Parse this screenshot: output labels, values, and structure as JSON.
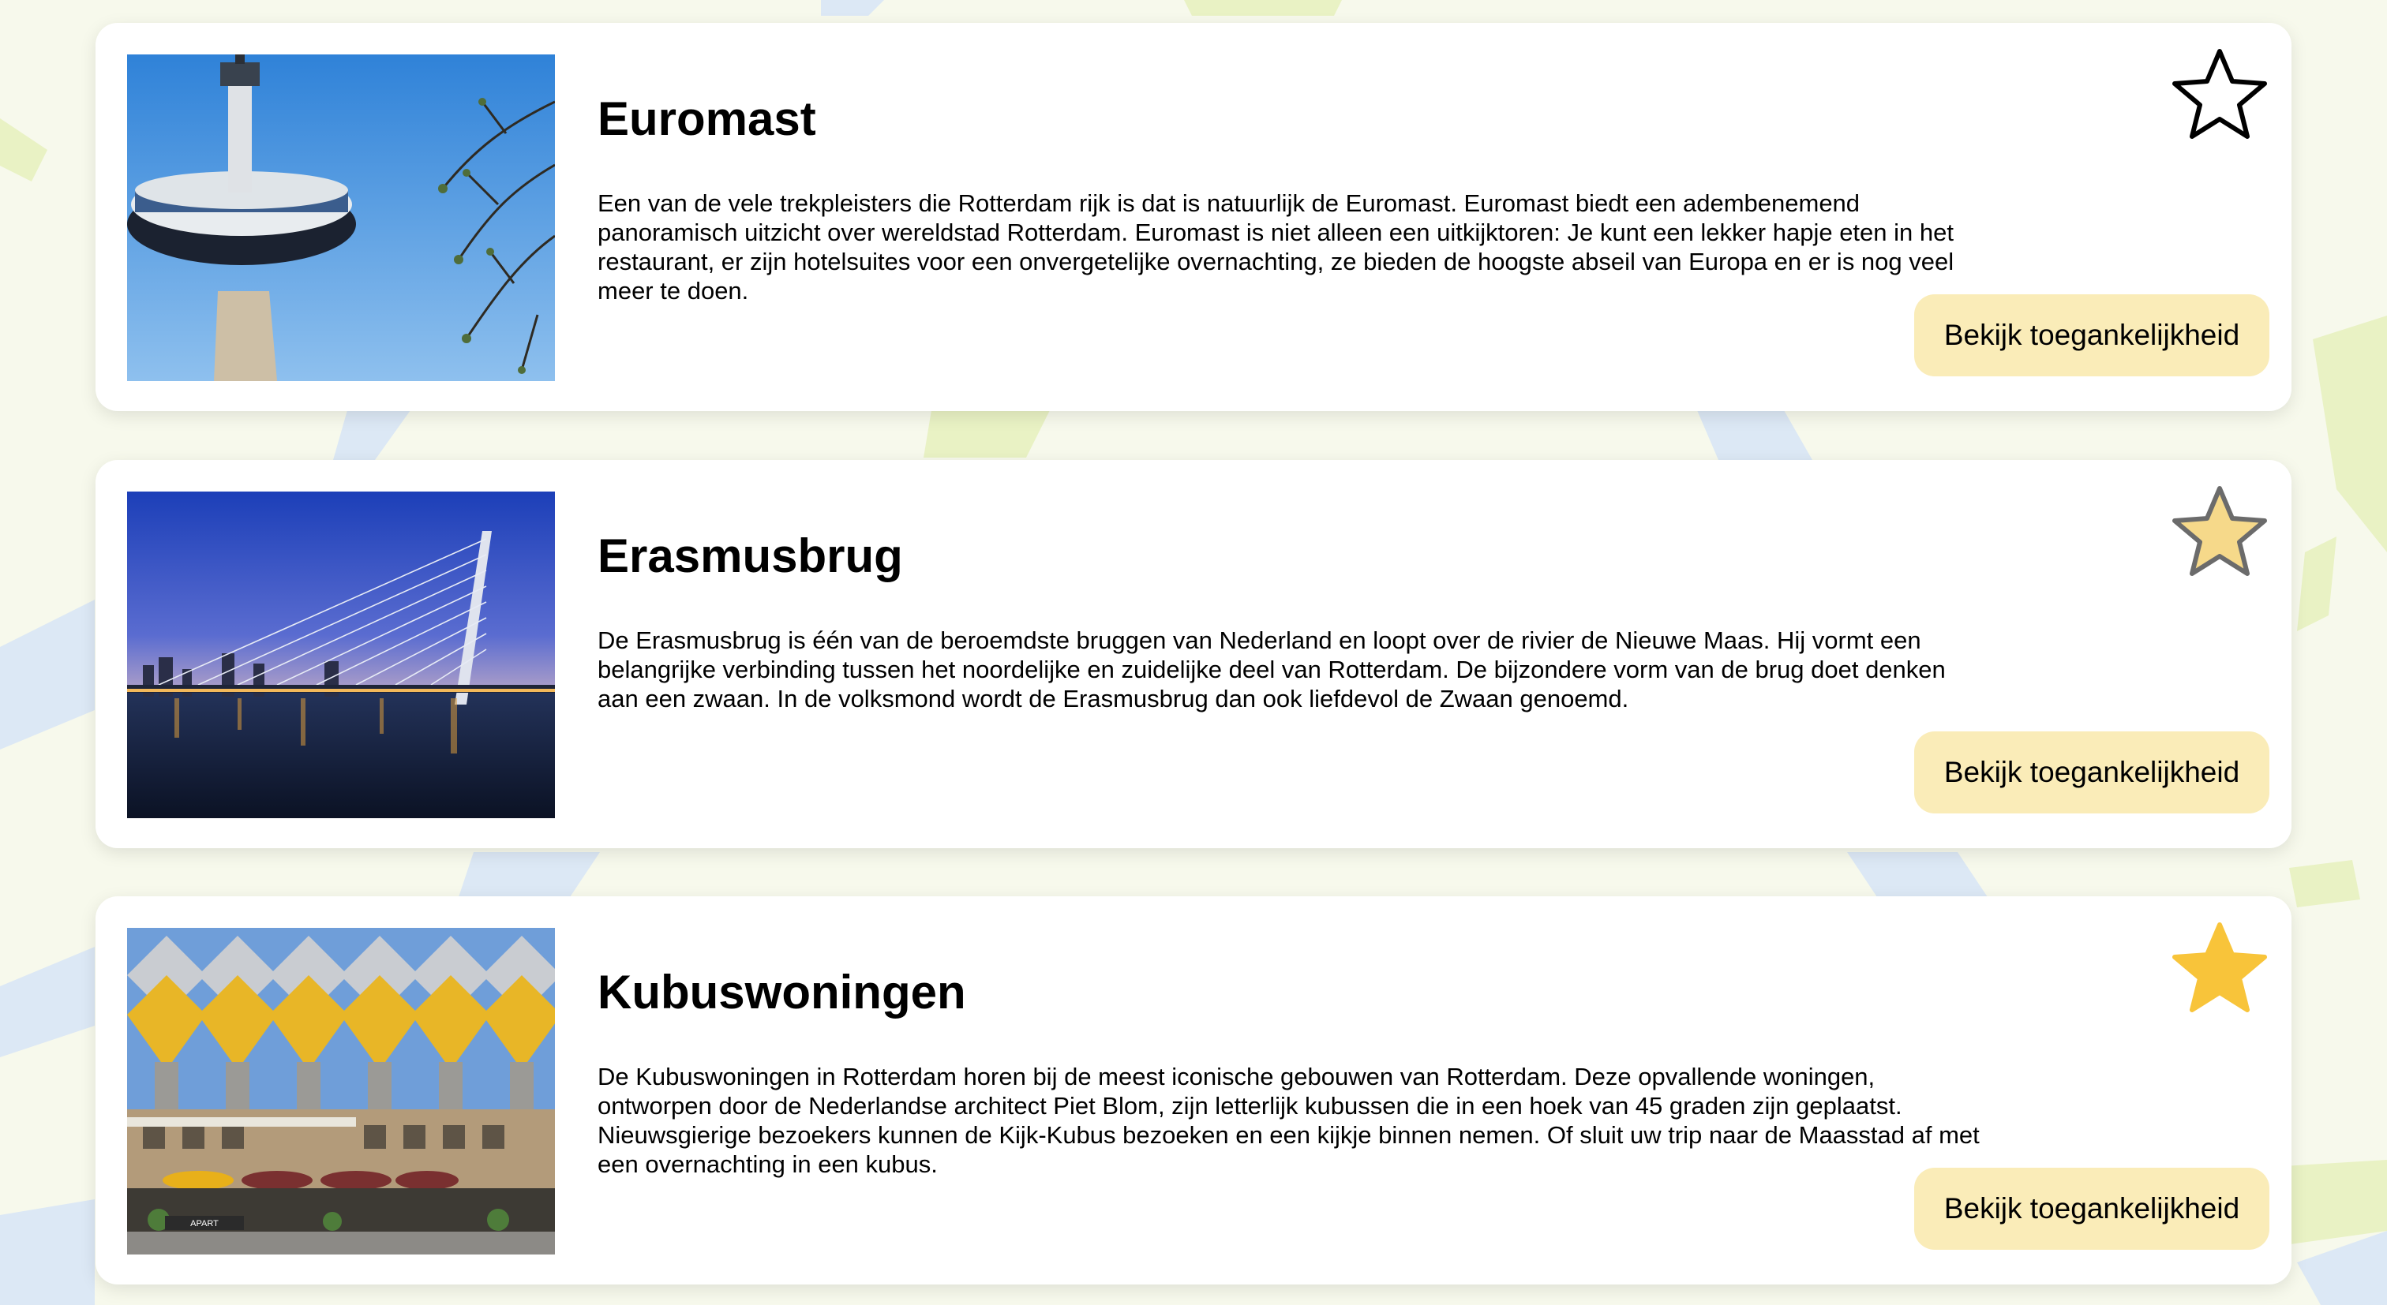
{
  "attractions": [
    {
      "title": "Euromast",
      "description": "Een van de vele trekpleisters die Rotterdam rijk is dat is natuurlijk de Euromast. Euromast biedt een adembenemend panoramisch uitzicht over wereldstad Rotterdam. Euromast is niet alleen een uitkijktoren: Je kunt een lekker hapje eten in het restaurant, er zijn hotelsuites voor een onvergetelijke overnachting, ze bieden de hoogste abseil van Europa en er is nog veel meer te doen.",
      "button_label": "Bekijk toegankelijkheid",
      "favorite_state": "empty",
      "image_subject": "euromast-tower-photo"
    },
    {
      "title": "Erasmusbrug",
      "description": "De Erasmusbrug is één van de beroemdste bruggen van Nederland en loopt over de rivier de Nieuwe Maas. Hij vormt een belangrijke verbinding tussen het noordelijke en zuidelijke deel van Rotterdam. De bijzondere vorm van de brug doet denken aan een zwaan. In de volksmond wordt de Erasmusbrug dan ook liefdevol de Zwaan genoemd.",
      "button_label": "Bekijk toegankelijkheid",
      "favorite_state": "hover",
      "image_subject": "erasmus-bridge-night-photo"
    },
    {
      "title": "Kubuswoningen",
      "description": "De Kubuswoningen in Rotterdam horen bij de meest iconische gebouwen van Rotterdam. Deze opvallende woningen, ontworpen door de Nederlandse architect Piet Blom, zijn letterlijk kubussen die in een hoek van 45 graden zijn geplaatst. Nieuwsgierige bezoekers kunnen de Kijk-Kubus bezoeken en een kijkje binnen nemen. Of sluit uw trip naar de Maasstad af met een overnachting in een kubus.",
      "button_label": "Bekijk toegankelijkheid",
      "favorite_state": "filled",
      "image_subject": "cube-houses-photo",
      "image_sign_text": "APART"
    }
  ],
  "colors": {
    "page_background": "#f7f9ec",
    "map_road": "#dce8f5",
    "map_park": "#e9f2c4",
    "card_background": "#ffffff",
    "button_background": "#faecb8",
    "star_filled": "#f8c43a",
    "star_hover_fill": "#f6d98a",
    "star_hover_stroke": "#6b6b6b",
    "star_empty_stroke": "#000000"
  },
  "icons": {
    "favorite": "star-icon"
  }
}
